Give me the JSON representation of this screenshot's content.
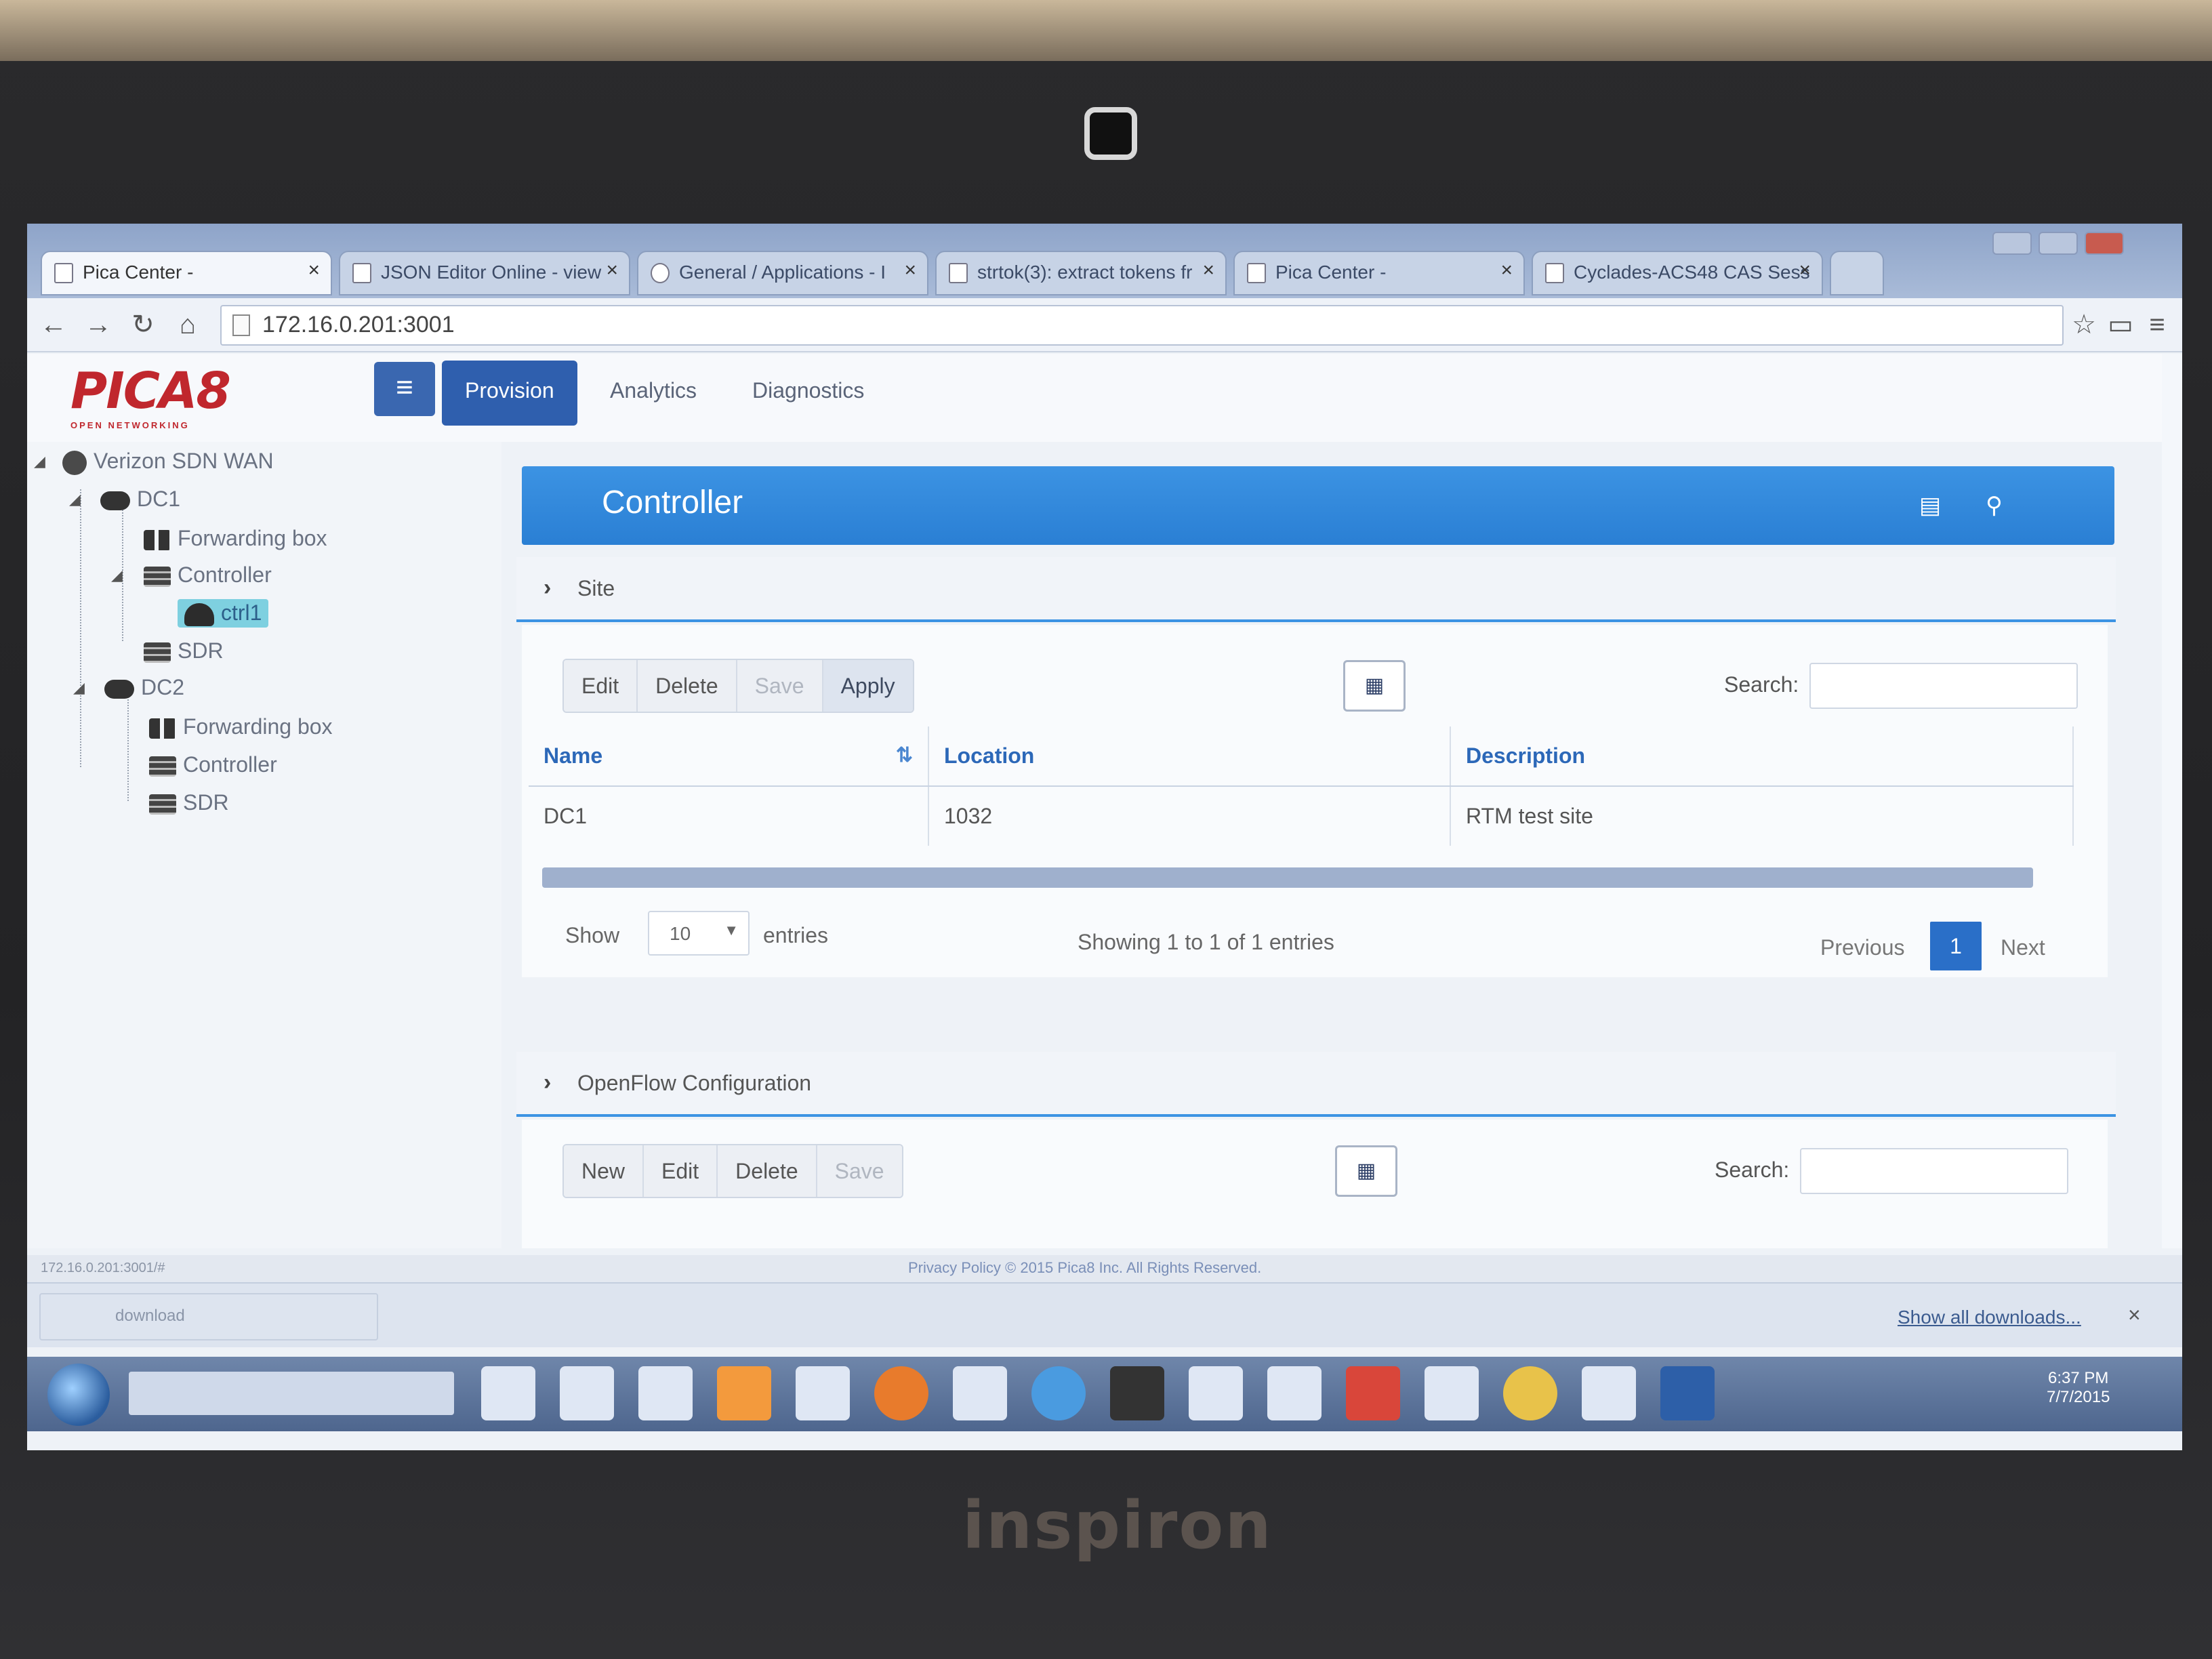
{
  "device": {
    "brand": "inspiron"
  },
  "browser": {
    "tabs": [
      {
        "label": "Pica Center -",
        "active": true
      },
      {
        "label": "JSON Editor Online - view",
        "active": false
      },
      {
        "label": "General / Applications - I",
        "active": false
      },
      {
        "label": "strtok(3): extract tokens fr",
        "active": false
      },
      {
        "label": "Pica Center -",
        "active": false
      },
      {
        "label": "Cyclades-ACS48 CAS Sess",
        "active": false
      }
    ],
    "tab_close": "×",
    "url": "172.16.0.201:3001",
    "status_url": "172.16.0.201:3001/#",
    "copyright": "Privacy Policy © 2015 Pica8 Inc. All Rights Reserved.",
    "download_item": "download",
    "show_all_downloads": "Show all downloads...",
    "download_close": "×"
  },
  "app": {
    "logo": {
      "text": "PICA8",
      "sub": "OPEN NETWORKING"
    },
    "menu_icon": "≡",
    "nav": [
      "Provision",
      "Analytics",
      "Diagnostics"
    ],
    "tree": {
      "root": "Verizon SDN WAN",
      "dc1": "DC1",
      "dc1_forwarding": "Forwarding box",
      "dc1_controller": "Controller",
      "dc1_ctrl1": "ctrl1",
      "dc1_sdr": "SDR",
      "dc2": "DC2",
      "dc2_forwarding": "Forwarding box",
      "dc2_controller": "Controller",
      "dc2_sdr": "SDR"
    },
    "panel_title": "Controller",
    "site": {
      "section_label": "Site",
      "buttons": {
        "edit": "Edit",
        "delete": "Delete",
        "save": "Save",
        "apply": "Apply"
      },
      "search_label": "Search:",
      "table": {
        "columns": [
          "Name",
          "Location",
          "Description"
        ],
        "rows": [
          [
            "DC1",
            "1032",
            "RTM test site"
          ]
        ]
      },
      "show_label": "Show",
      "entries_value": "10",
      "entries_label": "entries",
      "info": "Showing 1 to 1 of 1 entries",
      "pager": {
        "previous": "Previous",
        "current": "1",
        "next": "Next"
      }
    },
    "openflow": {
      "section_label": "OpenFlow Configuration",
      "buttons": {
        "new": "New",
        "edit": "Edit",
        "delete": "Delete",
        "save": "Save"
      },
      "search_label": "Search:"
    }
  },
  "taskbar": {
    "time": "6:37 PM",
    "date": "7/7/2015"
  },
  "colors": {
    "accent": "#2f5fae",
    "header_blue": "#3c93e3",
    "brand_red": "#c0272d"
  }
}
